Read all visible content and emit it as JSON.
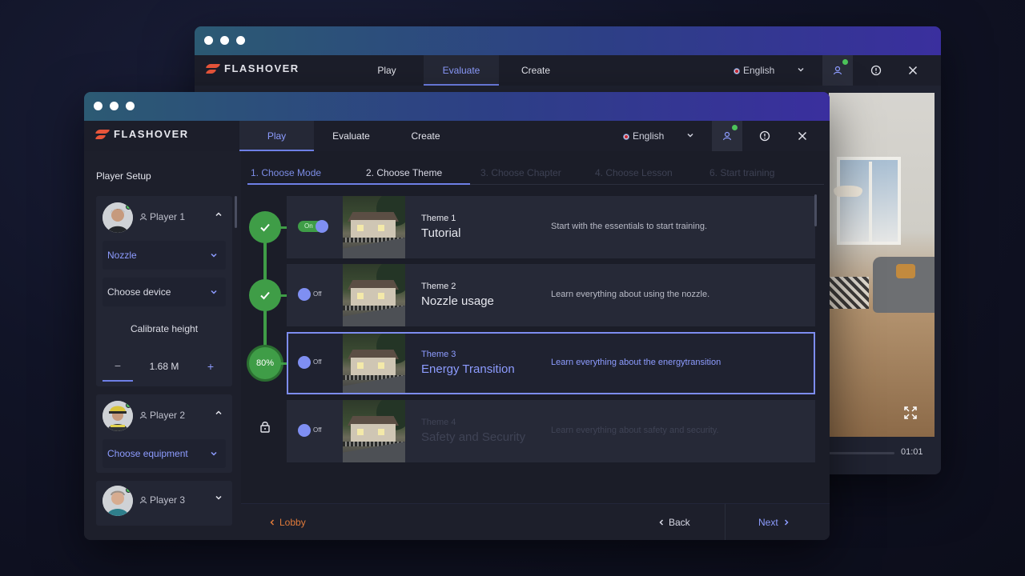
{
  "brand": "FLASHOVER",
  "tabs": [
    "Play",
    "Evaluate",
    "Create"
  ],
  "language": "English",
  "back_window": {
    "active_tab": "Evaluate",
    "video_time": "01:01"
  },
  "front_window": {
    "active_tab": "Play"
  },
  "sidebar": {
    "title": "Player Setup",
    "players": [
      {
        "name": "Player 1",
        "expanded": true,
        "equipment": "Nozzle",
        "device": "Choose device",
        "calibrate_label": "Calibrate height",
        "height": "1.68 M",
        "minus": "−",
        "plus": "+"
      },
      {
        "name": "Player 2",
        "expanded": true,
        "equipment": "Choose equipment"
      },
      {
        "name": "Player 3",
        "expanded": false
      }
    ]
  },
  "steps": [
    "1. Choose Mode",
    "2. Choose Theme",
    "3. Choose Chapter",
    "4. Choose Lesson",
    "6. Start training"
  ],
  "themes": [
    {
      "label": "Theme 1",
      "title": "Tutorial",
      "desc": "Start with the essentials to start training.",
      "toggle": "On",
      "status": "complete"
    },
    {
      "label": "Theme 2",
      "title": "Nozzle usage",
      "desc": "Learn everything about using the nozzle.",
      "toggle": "Off",
      "status": "complete"
    },
    {
      "label": "Theme 3",
      "title": "Energy Transition",
      "desc": "Learn everything about the energytransition",
      "toggle": "Off",
      "status": "in-progress",
      "progress": "80%"
    },
    {
      "label": "Theme 4",
      "title": "Safety and Security",
      "desc": "Learn everything about safety and security.",
      "toggle": "Off",
      "status": "locked"
    }
  ],
  "footer": {
    "lobby": "Lobby",
    "back": "Back",
    "next": "Next"
  },
  "colors": {
    "accent": "#7d8df0",
    "success": "#3f9d47",
    "lobby": "#e07a3a",
    "titlebar_start": "#2c5a73",
    "titlebar_end": "#3a2f9e"
  }
}
